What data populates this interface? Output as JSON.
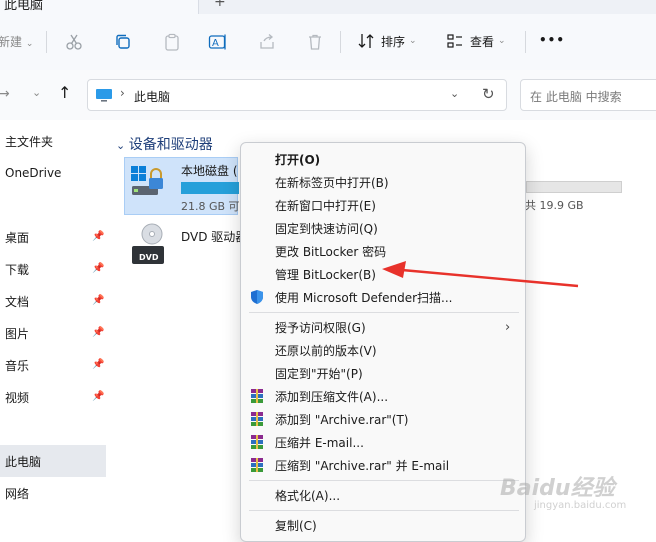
{
  "window": {
    "tab_title": "此电脑",
    "new_tab_glyph": "+"
  },
  "toolbar": {
    "new_label": "新建",
    "sort_label": "排序",
    "view_label": "查看",
    "more_label": "•••",
    "icons": [
      "cut-icon",
      "copy-icon",
      "paste-icon",
      "rename-icon",
      "share-icon",
      "delete-icon",
      "sort-icon",
      "view-icon"
    ]
  },
  "address": {
    "location": "此电脑",
    "search_placeholder": "在 此电脑 中搜索"
  },
  "sidebar": {
    "items": [
      {
        "label": "主文件夹",
        "pinned": false
      },
      {
        "label": "OneDrive",
        "pinned": false
      },
      {
        "label": "桌面",
        "pinned": true
      },
      {
        "label": "下载",
        "pinned": true
      },
      {
        "label": "文档",
        "pinned": true
      },
      {
        "label": "图片",
        "pinned": true
      },
      {
        "label": "音乐",
        "pinned": true
      },
      {
        "label": "视频",
        "pinned": true
      },
      {
        "label": "此电脑",
        "pinned": false,
        "selected": true
      },
      {
        "label": "网络",
        "pinned": false
      }
    ]
  },
  "content": {
    "group_header": "设备和驱动器",
    "drives": [
      {
        "name": "本地磁盘 (",
        "free_text": "21.8 GB 可",
        "right_text": "共 19.9 GB",
        "used_fraction": 0.7
      },
      {
        "name": "DVD 驱动器",
        "badge": "DVD"
      }
    ]
  },
  "context_menu": {
    "items": [
      {
        "label": "打开(O)",
        "bold": true,
        "icon": ""
      },
      {
        "label": "在新标签页中打开(B)",
        "icon": ""
      },
      {
        "label": "在新窗口中打开(E)",
        "icon": ""
      },
      {
        "label": "固定到快速访问(Q)",
        "icon": ""
      },
      {
        "label": "更改 BitLocker 密码",
        "icon": ""
      },
      {
        "label": "管理 BitLocker(B)",
        "icon": ""
      },
      {
        "label": "使用 Microsoft Defender扫描...",
        "icon": "defender-shield-icon"
      },
      {
        "label": "授予访问权限(G)",
        "icon": "",
        "submenu": true
      },
      {
        "label": "还原以前的版本(V)",
        "icon": ""
      },
      {
        "label": "固定到\"开始\"(P)",
        "icon": ""
      },
      {
        "label": "添加到压缩文件(A)...",
        "icon": "winrar-icon"
      },
      {
        "label": "添加到 \"Archive.rar\"(T)",
        "icon": "winrar-icon"
      },
      {
        "label": "压缩并 E-mail...",
        "icon": "winrar-icon"
      },
      {
        "label": "压缩到 \"Archive.rar\" 并 E-mail",
        "icon": "winrar-icon"
      },
      {
        "label": "格式化(A)...",
        "icon": ""
      },
      {
        "label": "复制(C)",
        "icon": ""
      }
    ]
  },
  "annotation": {
    "arrow_color": "#e8322b",
    "points_to": "管理 BitLocker(B)"
  },
  "watermark": {
    "text": "Baidu经验",
    "sub": "jingyan.baidu.com"
  },
  "colors": {
    "accent": "#0067c0",
    "selection": "#cfe3fa",
    "drive_bar": "#26a0da"
  }
}
